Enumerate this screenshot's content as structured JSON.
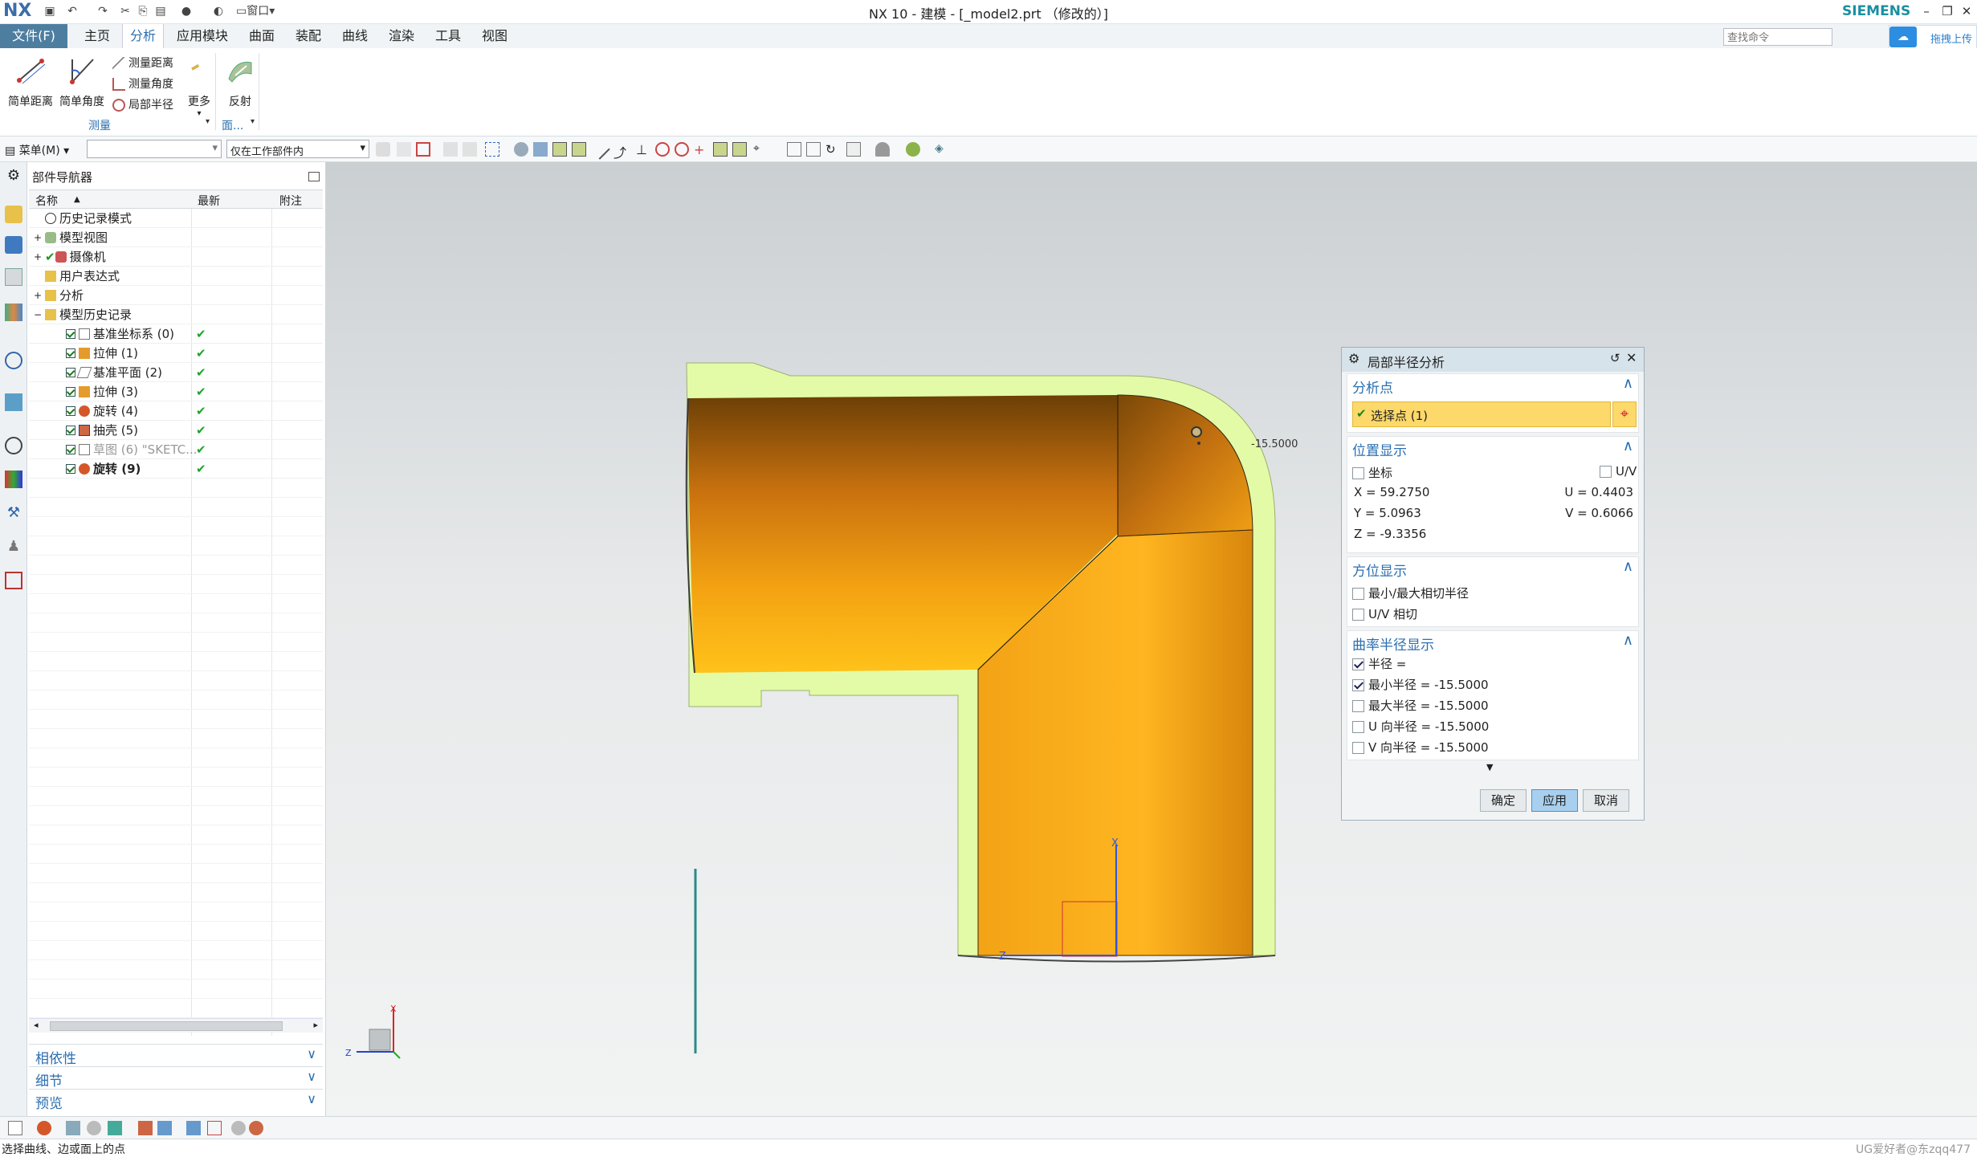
{
  "app": {
    "logo": "NX",
    "title": "NX 10 - 建模 - [_model2.prt （修改的）]",
    "brand": "SIEMENS",
    "window_menu": "窗口",
    "upload_label": "拖拽上传"
  },
  "menubar": {
    "file": "文件(F)",
    "tabs": [
      "主页",
      "分析",
      "应用模块",
      "曲面",
      "装配",
      "曲线",
      "渲染",
      "工具",
      "视图"
    ],
    "active_tab": "分析",
    "search_placeholder": "查找命令"
  },
  "ribbon": {
    "simple_distance": "简单距离",
    "simple_angle": "简单角度",
    "measure_distance": "测量距离",
    "measure_angle": "测量角度",
    "local_radius": "局部半径",
    "more": "更多",
    "reflect": "反射",
    "group_measure": "测量",
    "group_face": "面..."
  },
  "toolbar": {
    "menu_label": "菜单(M)",
    "filter_value": "",
    "scope_value": "仅在工作部件内"
  },
  "navigator": {
    "title": "部件导航器",
    "columns": [
      "名称",
      "最新",
      "附注"
    ],
    "items": [
      {
        "label": "历史记录模式",
        "latest": ""
      },
      {
        "label": "模型视图",
        "latest": ""
      },
      {
        "label": "摄像机",
        "latest": ""
      },
      {
        "label": "用户表达式",
        "latest": ""
      },
      {
        "label": "分析",
        "latest": ""
      },
      {
        "label": "模型历史记录",
        "latest": ""
      },
      {
        "label": "基准坐标系 (0)",
        "latest": "✔"
      },
      {
        "label": "拉伸 (1)",
        "latest": "✔"
      },
      {
        "label": "基准平面 (2)",
        "latest": "✔"
      },
      {
        "label": "拉伸 (3)",
        "latest": "✔"
      },
      {
        "label": "旋转 (4)",
        "latest": "✔"
      },
      {
        "label": "抽壳 (5)",
        "latest": "✔"
      },
      {
        "label": "草图 (6) \"SKETC...",
        "latest": "✔"
      },
      {
        "label": "旋转 (9)",
        "latest": "✔"
      }
    ],
    "panels": [
      "相依性",
      "细节",
      "预览"
    ]
  },
  "viewport": {
    "radius_label": "-15.5000",
    "axis_x": "X",
    "axis_z": "Z",
    "colors": {
      "shell": "#f2a516",
      "rim": "#e3fba7"
    }
  },
  "dialog": {
    "title": "局部半径分析",
    "section_points": "分析点",
    "select_point": "选择点 (1)",
    "section_position": "位置显示",
    "coord_label": "坐标",
    "uv_label": "U/V",
    "x_value": "X = 59.2750",
    "y_value": "Y = 5.0963",
    "z_value": "Z = -9.3356",
    "u_value": "U = 0.4403",
    "v_value": "V = 0.6066",
    "section_orientation": "方位显示",
    "min_max_tangent": "最小/最大相切半径",
    "uv_tangent": "U/V 相切",
    "section_curvature": "曲率半径显示",
    "radius": "半径 =",
    "min_radius": "最小半径 = -15.5000",
    "max_radius": "最大半径 = -15.5000",
    "u_radius": "U 向半径 = -15.5000",
    "v_radius": "V 向半径 = -15.5000",
    "ok": "确定",
    "apply": "应用",
    "cancel": "取消"
  },
  "status": {
    "prompt": "选择曲线、边或面上的点",
    "watermark": "UG爱好者@东zqq477"
  }
}
